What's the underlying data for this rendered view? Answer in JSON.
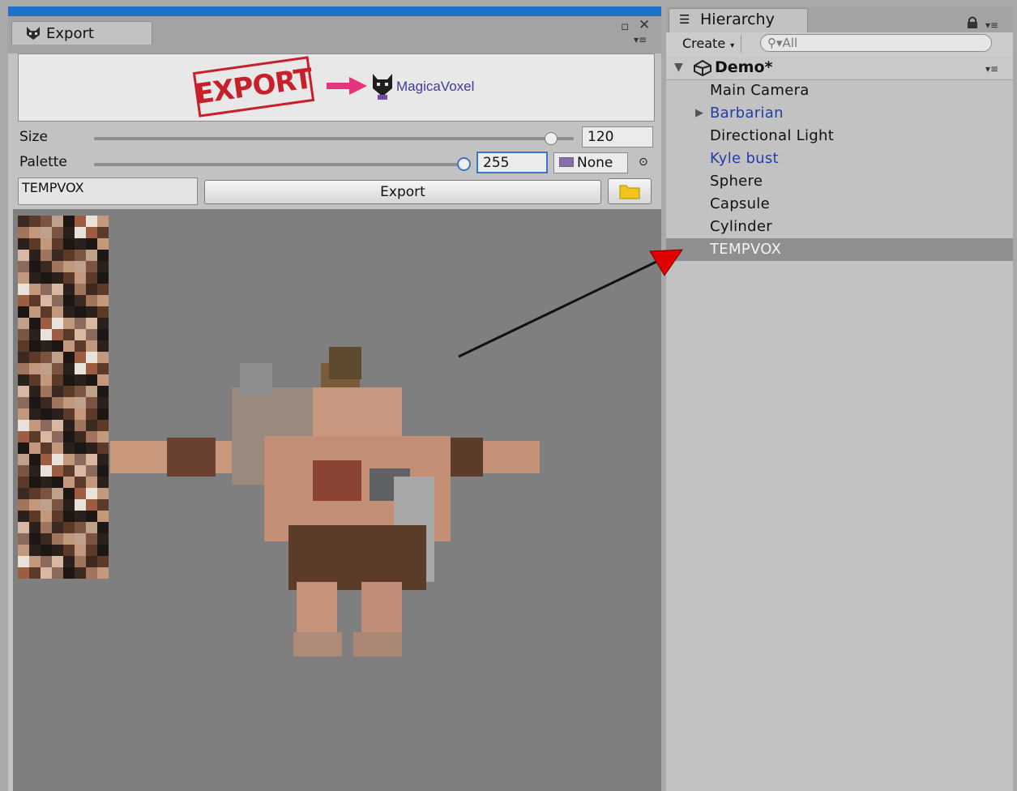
{
  "export_window": {
    "tab_title": "Export",
    "banner": {
      "stamp_text": "EXPORT",
      "target_app": "MagicaVoxel"
    },
    "size": {
      "label": "Size",
      "value": "120",
      "fraction": 0.96
    },
    "palette": {
      "label": "Palette",
      "value": "255",
      "fraction": 1.0,
      "object_field": "None"
    },
    "name_field": "TEMPVOX",
    "export_button": "Export"
  },
  "hierarchy": {
    "tab_title": "Hierarchy",
    "create_label": "Create",
    "search_placeholder": "All",
    "scene": "Demo*",
    "items": [
      {
        "label": "Main Camera",
        "prefab": false,
        "expandable": false,
        "selected": false
      },
      {
        "label": "Barbarian",
        "prefab": true,
        "expandable": true,
        "selected": false
      },
      {
        "label": "Directional Light",
        "prefab": false,
        "expandable": false,
        "selected": false
      },
      {
        "label": "Kyle bust",
        "prefab": true,
        "expandable": false,
        "selected": false
      },
      {
        "label": "Sphere",
        "prefab": false,
        "expandable": false,
        "selected": false
      },
      {
        "label": "Capsule",
        "prefab": false,
        "expandable": false,
        "selected": false
      },
      {
        "label": "Cylinder",
        "prefab": false,
        "expandable": false,
        "selected": false
      },
      {
        "label": "TEMPVOX",
        "prefab": false,
        "expandable": false,
        "selected": true
      }
    ]
  },
  "colors": {
    "accent": "#1e73c8",
    "prefab_text": "#1f3fa8",
    "stamp_red": "#c8202a",
    "annotation_red": "#e00000"
  },
  "icons": [
    "magicavoxel-icon",
    "maximize-icon",
    "close-icon",
    "panel-menu-icon",
    "arrow-right-icon",
    "unity-scene-icon",
    "lock-icon",
    "folder-icon",
    "object-picker-icon",
    "search-icon",
    "expand-triangle-icon"
  ]
}
